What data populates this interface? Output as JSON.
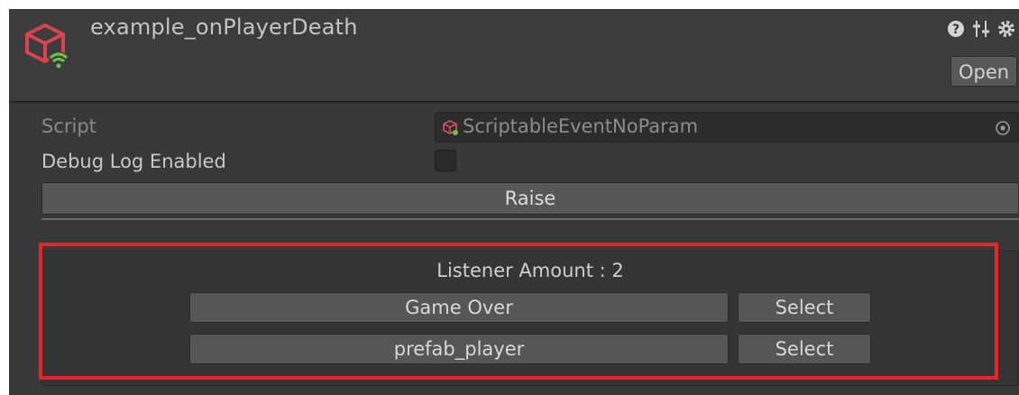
{
  "header": {
    "title": "example_onPlayerDeath",
    "open_label": "Open",
    "icons": [
      "scriptable-event-icon",
      "help-icon",
      "preset-sliders-icon",
      "settings-icon"
    ]
  },
  "fields": {
    "script_label": "Script",
    "script_value": "ScriptableEventNoParam",
    "debug_label": "Debug Log Enabled",
    "debug_checked": false
  },
  "raise_label": "Raise",
  "listeners": {
    "amount_text": "Listener Amount : 2",
    "items": [
      {
        "name": "Game Over",
        "select_label": "Select"
      },
      {
        "name": "prefab_player",
        "select_label": "Select"
      }
    ]
  },
  "colors": {
    "panel_bg": "#383838",
    "highlight": "#e8242b",
    "asset_icon": "#d64550",
    "wifi_icon": "#6cc24a"
  }
}
